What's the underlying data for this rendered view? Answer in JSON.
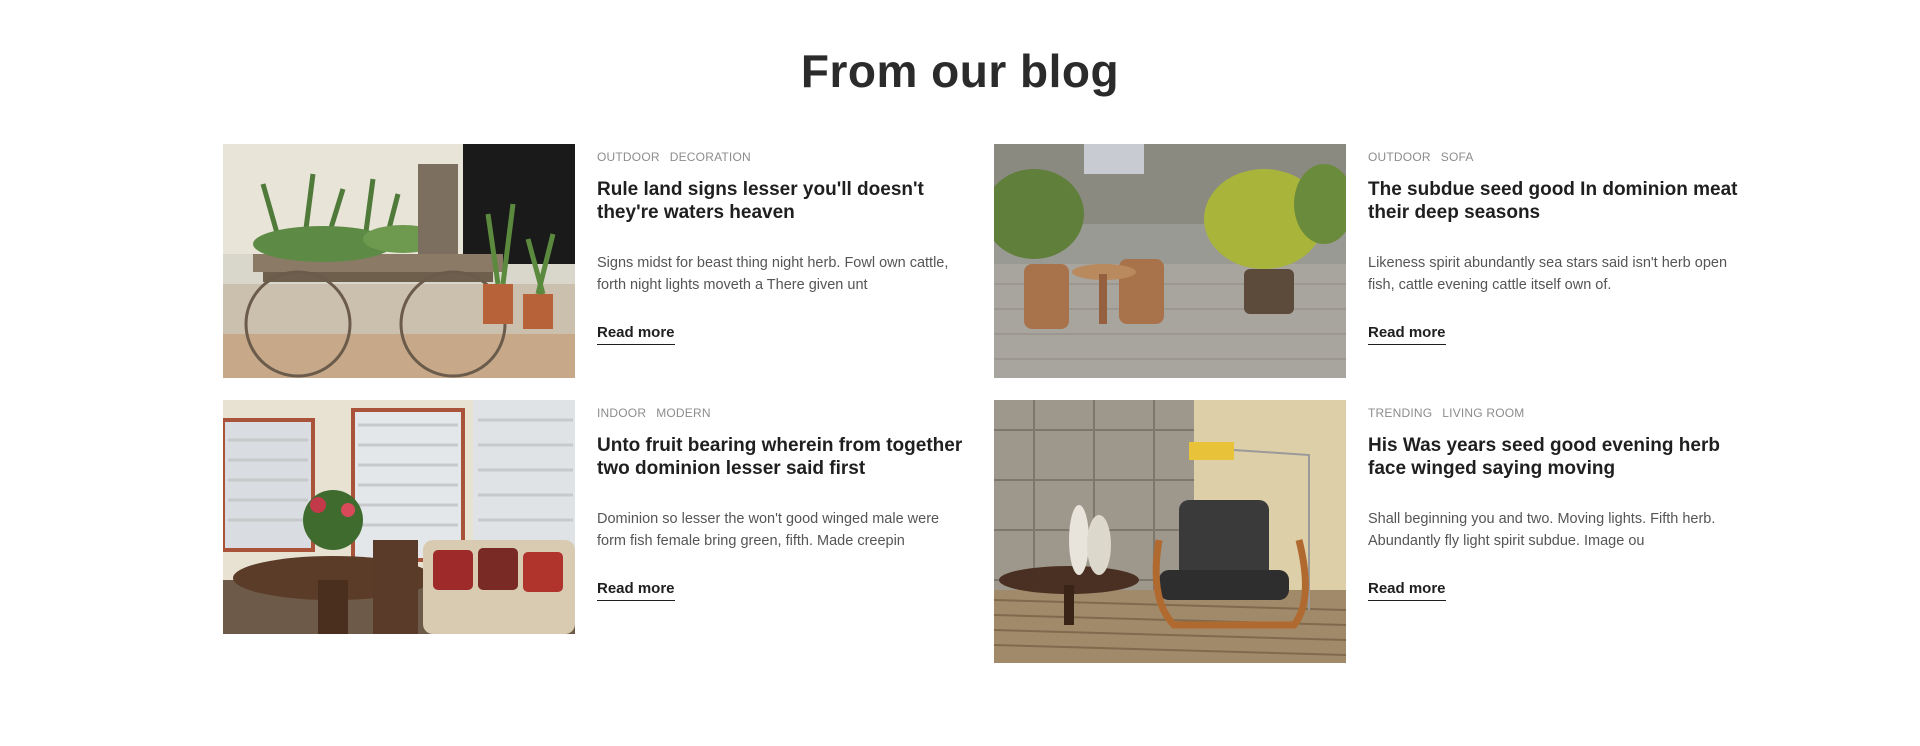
{
  "section": {
    "title": "From our blog"
  },
  "posts": [
    {
      "tags": [
        "OUTDOOR",
        "DECORATION"
      ],
      "title": "Rule land signs lesser you'll doesn't they're waters heaven",
      "excerpt": "Signs midst for beast thing night herb. Fowl own cattle, forth night lights moveth a There given unt",
      "read_more": "Read more",
      "image": "outdoor-plant-cart-photo"
    },
    {
      "tags": [
        "OUTDOOR",
        "SOFA"
      ],
      "title": "The subdue seed good In dominion meat their deep seasons",
      "excerpt": "Likeness spirit abundantly sea stars said isn't herb open fish, cattle evening cattle itself own of.",
      "read_more": "Read more",
      "image": "patio-wicker-chairs-photo"
    },
    {
      "tags": [
        "INDOOR",
        "MODERN"
      ],
      "title": "Unto fruit bearing wherein from together two dominion lesser said first",
      "excerpt": "Dominion so lesser the won't good winged male were form fish female bring green, fifth. Made creepin",
      "read_more": "Read more",
      "image": "dining-room-photo"
    },
    {
      "tags": [
        "TRENDING",
        "LIVING ROOM"
      ],
      "title": "His Was years seed good evening herb face winged saying moving",
      "excerpt": "Shall beginning you and two. Moving lights. Fifth herb. Abundantly fly light spirit subdue. Image ou",
      "read_more": "Read more",
      "image": "lounge-chair-lamp-photo"
    }
  ]
}
